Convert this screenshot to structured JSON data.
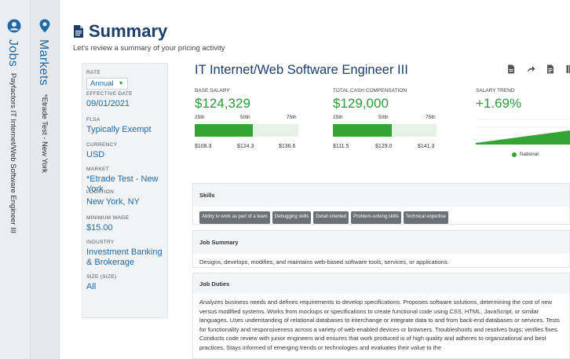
{
  "rail": {
    "jobs": {
      "title": "Jobs",
      "subtitle": "Payfactors IT Internet/Web Software Engineer III",
      "icon": "user-circle-icon"
    },
    "markets": {
      "title": "Markets",
      "subtitle": "*Etrade Test - New York",
      "icon": "map-pin-icon"
    }
  },
  "page": {
    "title": "Summary",
    "subtitle": "Let's review a summary of your pricing activity",
    "icon": "document-icon"
  },
  "sidebar": {
    "rate": {
      "label": "RATE",
      "value": "Annual"
    },
    "effective_date": {
      "label": "EFFECTIVE DATE",
      "value": "09/01/2021"
    },
    "flsa": {
      "label": "FLSA",
      "value": "Typically Exempt"
    },
    "currency": {
      "label": "CURRENCY",
      "value": "USD"
    },
    "market": {
      "label": "MARKET",
      "value": "*Etrade Test - New York"
    },
    "location": {
      "label": "LOCATION",
      "value": "New York, NY"
    },
    "minimum_wage": {
      "label": "MINIMUM WAGE",
      "value": "$15.00"
    },
    "industry": {
      "label": "INDUSTRY",
      "value": "Investment Banking & Brokerage"
    },
    "size": {
      "label": "SIZE (SIZE)",
      "value": "All"
    }
  },
  "job": {
    "title": "IT Internet/Web Software Engineer III",
    "header_icons": [
      "pdf-icon",
      "share-icon",
      "file-icon",
      "columns-icon"
    ]
  },
  "stats": {
    "base_salary": {
      "label": "BASE SALARY",
      "value": "$124,329",
      "p25_label": "25th",
      "p50_label": "50th",
      "p75_label": "75th",
      "p25": "$108.3",
      "p50": "$124.3",
      "p75": "$136.6",
      "fill_fraction": 0.56
    },
    "total_cash": {
      "label": "TOTAL CASH COMPENSATION",
      "value": "$129,000",
      "p25_label": "25th",
      "p50_label": "50th",
      "p75_label": "75th",
      "p25": "$111.5",
      "p50": "$129.0",
      "p75": "$141.3",
      "fill_fraction": 0.57
    },
    "salary_trend": {
      "label": "SALARY TREND",
      "value": "+1.69%",
      "legend": "National",
      "color": "#33a532"
    }
  },
  "sections": {
    "skills": {
      "title": "Skills",
      "chips": [
        "Ability to work as part of a team",
        "Debugging skills",
        "Detail oriented",
        "Problem-solving skills",
        "Technical expertise"
      ]
    },
    "job_summary": {
      "title": "Job Summary",
      "text": "Designs, develops, modifies, and maintains web-based software tools, services, or applications."
    },
    "job_duties": {
      "title": "Job Duties",
      "text": "Analyzes business needs and defines requirements to develop specifications. Proposes software solutions, determining the cost of new versus modified systems. Works from mockups or specifications to create functional code using CSS, HTML, JavaScript, or similar languages. Uses understanding of relational databases to interchange or integrate data to and from back-end databases or services. Tests for functionality and responsiveness across a variety of web-enabled devices or browsers. Troubleshoots and resolves bugs; verifies fixes. Conducts code review with junior engineers and ensures that work produced is of high quality and adheres to organizational and best practices. Stays informed of emerging trends or technologies and evaluates their value to the"
    }
  },
  "colors": {
    "accent": "#1f6aa6",
    "title": "#1b3e6b",
    "green": "#33a532"
  }
}
